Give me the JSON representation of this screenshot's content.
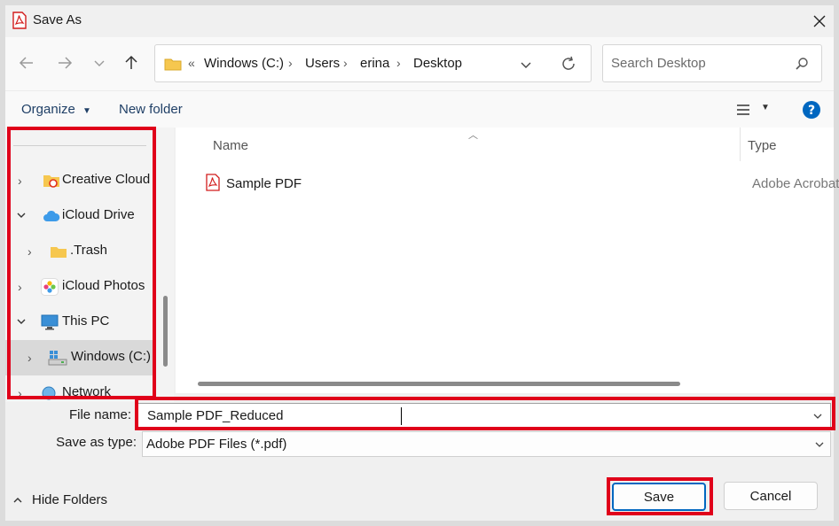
{
  "window": {
    "title": "Save As",
    "close_label": "✕"
  },
  "nav": {
    "breadcrumb_prefix": "«",
    "breadcrumbs": [
      "Windows (C:)",
      "Users",
      "erina",
      "Desktop"
    ],
    "search_placeholder": "Search Desktop"
  },
  "toolbar": {
    "organize_label": "Organize",
    "new_folder_label": "New folder"
  },
  "tree": {
    "items": [
      {
        "label": "Creative Cloud"
      },
      {
        "label": "iCloud Drive"
      },
      {
        "label": ".Trash"
      },
      {
        "label": "iCloud Photos"
      },
      {
        "label": "This PC"
      },
      {
        "label": "Windows (C:)"
      },
      {
        "label": "Network"
      }
    ]
  },
  "filelist": {
    "columns": [
      "Name",
      "Type"
    ],
    "rows": [
      {
        "name": "Sample PDF",
        "type": "Adobe Acrobat"
      }
    ]
  },
  "form": {
    "file_name_label": "File name:",
    "file_name_value": "Sample PDF_Reduced",
    "save_type_label": "Save as type:",
    "save_type_value": "Adobe PDF Files (*.pdf)"
  },
  "footer": {
    "hide_folders_label": "Hide Folders",
    "save_label": "Save",
    "cancel_label": "Cancel"
  },
  "colors": {
    "highlight": "#e0001a",
    "accent": "#0067c0",
    "pdf_red": "#d21c1c"
  }
}
